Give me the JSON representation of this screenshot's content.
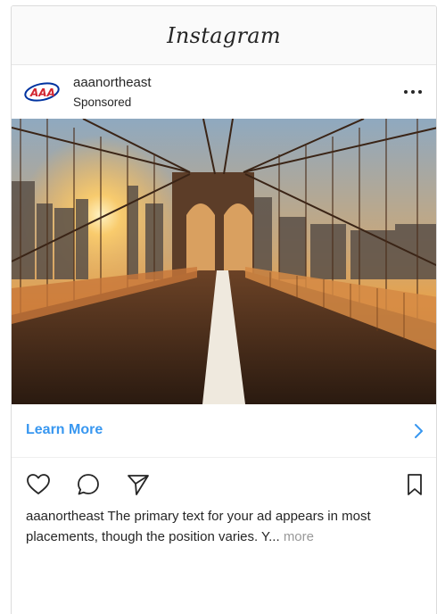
{
  "app": {
    "logo_text": "Instagram"
  },
  "post": {
    "username": "aaanortheast",
    "sponsored_label": "Sponsored",
    "avatar_icon": "aaa-logo-icon",
    "more_icon": "more-options-icon",
    "image_description_icon": "photo",
    "cta": {
      "label": "Learn More",
      "chevron_icon": "chevron-right-icon"
    },
    "actions": {
      "like_icon": "heart-icon",
      "comment_icon": "comment-icon",
      "share_icon": "send-icon",
      "save_icon": "bookmark-icon"
    },
    "caption": {
      "username": "aaanortheast",
      "text": "The primary text for your ad appears in most placements, though the position varies. Y...",
      "more": "more"
    }
  },
  "colors": {
    "link_blue": "#3897f0",
    "aaa_red": "#d22630",
    "aaa_blue": "#0033a0"
  }
}
